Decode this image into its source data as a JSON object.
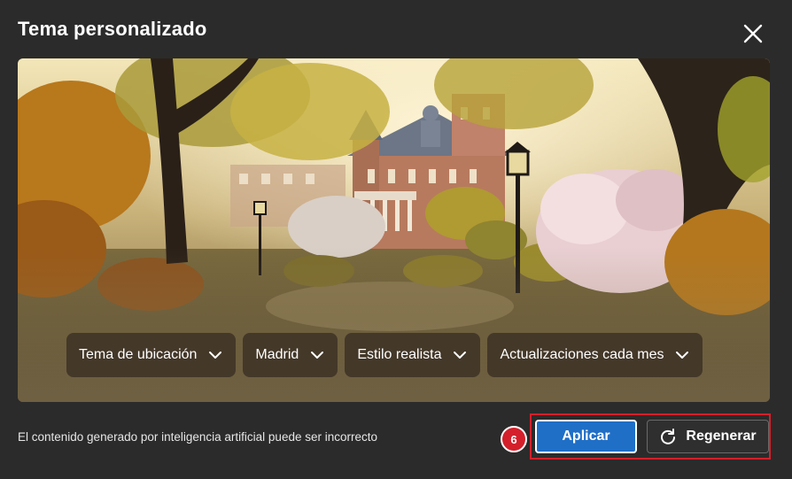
{
  "dialog": {
    "title": "Tema personalizado",
    "close_icon": "close-icon"
  },
  "preview": {
    "image_subject": "park-garden-with-palace",
    "options": [
      {
        "label": "Tema de ubicación",
        "icon": "chevron-down-icon"
      },
      {
        "label": "Madrid",
        "icon": "chevron-down-icon"
      },
      {
        "label": "Estilo realista",
        "icon": "chevron-down-icon"
      },
      {
        "label": "Actualizaciones cada mes",
        "icon": "chevron-down-icon"
      }
    ]
  },
  "footer": {
    "disclaimer": "El contenido generado por inteligencia artificial puede ser incorrecto",
    "step_badge": "6",
    "apply_label": "Aplicar",
    "regenerate_label": "Regenerar",
    "regenerate_icon": "refresh-icon"
  },
  "colors": {
    "background": "#2b2b2b",
    "accent_blue": "#1f6fc7",
    "highlight_red": "#d4202b"
  }
}
